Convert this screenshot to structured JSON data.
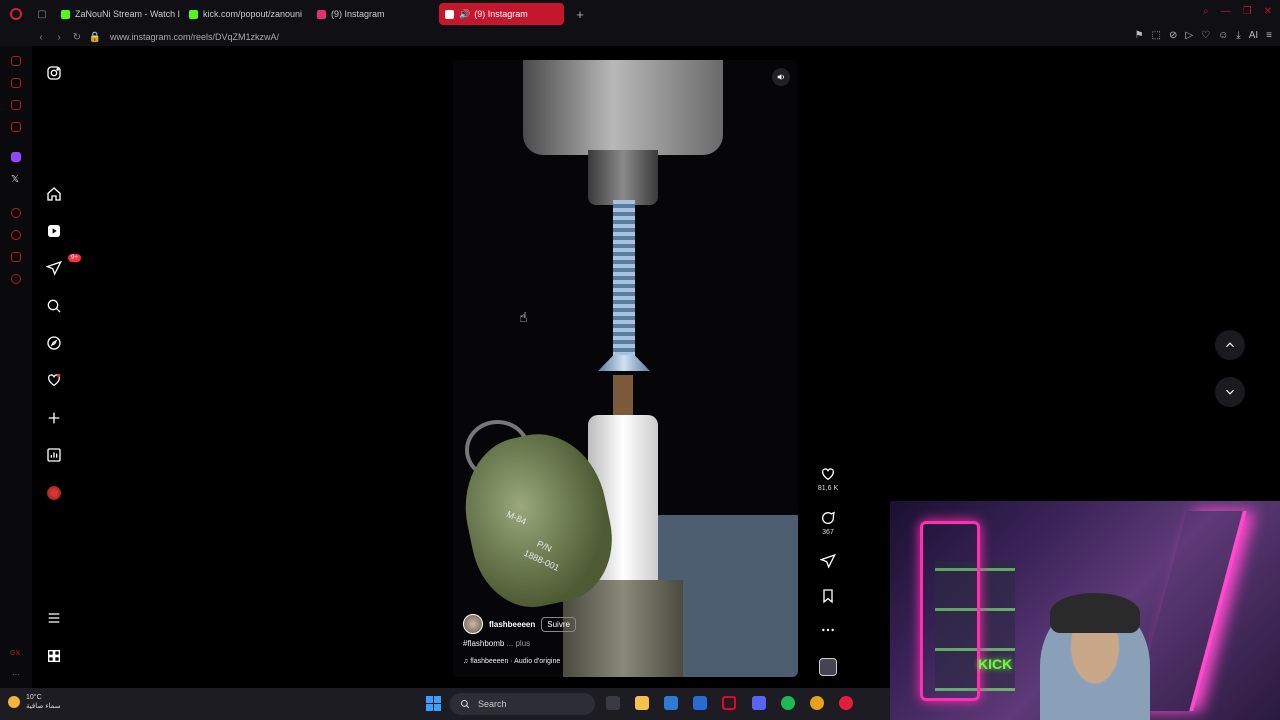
{
  "browser": {
    "tabs": [
      {
        "title": "ZaNouNi Stream - Watch l",
        "favicon_color": "#53fc18",
        "active": false
      },
      {
        "title": "kick.com/popout/zanouni",
        "favicon_color": "#53fc18",
        "active": false
      },
      {
        "title": "(9) Instagram",
        "favicon_color": "#e1306c",
        "active": false
      },
      {
        "title": "(9) Instagram",
        "favicon_color": "#e1306c",
        "active": true
      }
    ],
    "url": "www.instagram.com/reels/DVqZM1zkzwA/",
    "right_label": "AI"
  },
  "instagram": {
    "nav": [
      {
        "name": "instagram-logo-icon"
      },
      {
        "name": "home-icon"
      },
      {
        "name": "reels-icon"
      },
      {
        "name": "messages-icon",
        "badge": "9+"
      },
      {
        "name": "search-icon"
      },
      {
        "name": "explore-icon"
      },
      {
        "name": "notifications-icon"
      },
      {
        "name": "create-icon"
      },
      {
        "name": "dashboard-icon"
      },
      {
        "name": "profile-avatar"
      },
      {
        "name": "menu-icon"
      },
      {
        "name": "threads-icon"
      }
    ],
    "reel": {
      "author": "flashbeeeen",
      "follow_label": "Suivre",
      "caption_tag": "#flashbomb",
      "caption_more": "... plus",
      "audio": "flashbeeeen · Audio d'origine",
      "grenade_text_1": "M-84",
      "grenade_text_2": "P/N",
      "grenade_text_3": "1888-001"
    },
    "actions": {
      "likes": "81,6 K",
      "comments": "367"
    }
  },
  "taskbar": {
    "temperature": "10°C",
    "weather_desc": "سماء صافية",
    "search_label": "Search"
  },
  "webcam": {
    "sign": "KICK"
  }
}
